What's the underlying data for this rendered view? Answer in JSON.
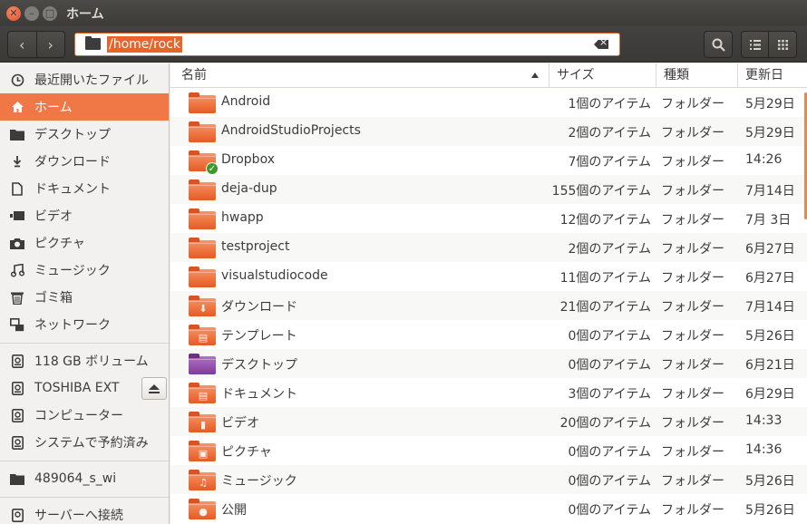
{
  "window": {
    "title": "ホーム"
  },
  "headerbar": {
    "path": "/home/rock"
  },
  "sidebar": {
    "items": [
      {
        "label": "最近開いたファイル",
        "icon": "clock-icon"
      },
      {
        "label": "ホーム",
        "icon": "home-icon",
        "active": true
      },
      {
        "label": "デスクトップ",
        "icon": "folder-icon"
      },
      {
        "label": "ダウンロード",
        "icon": "download-icon"
      },
      {
        "label": "ドキュメント",
        "icon": "document-icon"
      },
      {
        "label": "ビデオ",
        "icon": "video-icon"
      },
      {
        "label": "ピクチャ",
        "icon": "camera-icon"
      },
      {
        "label": "ミュージック",
        "icon": "music-icon"
      },
      {
        "label": "ゴミ箱",
        "icon": "trash-icon"
      },
      {
        "label": "ネットワーク",
        "icon": "network-icon"
      }
    ],
    "devices": [
      {
        "label": "118 GB ボリューム",
        "icon": "drive-icon"
      },
      {
        "label": "TOSHIBA EXT",
        "icon": "drive-icon",
        "ejectable": true
      },
      {
        "label": "コンピューター",
        "icon": "drive-icon"
      },
      {
        "label": "システムで予約済み",
        "icon": "drive-icon"
      }
    ],
    "bookmarks": [
      {
        "label": "489064_s_wi",
        "icon": "folder-icon"
      }
    ],
    "other": [
      {
        "label": "サーバーへ接続",
        "icon": "server-icon"
      }
    ]
  },
  "columns": {
    "name": "名前",
    "size": "サイズ",
    "type": "種類",
    "modified": "更新日"
  },
  "files": [
    {
      "name": "Android",
      "size": "1個のアイテム",
      "type": "フォルダー",
      "modified": "5月29日"
    },
    {
      "name": "AndroidStudioProjects",
      "size": "2個のアイテム",
      "type": "フォルダー",
      "modified": "5月29日"
    },
    {
      "name": "Dropbox",
      "size": "7個のアイテム",
      "type": "フォルダー",
      "modified": "14:26",
      "emblem": "check"
    },
    {
      "name": "deja-dup",
      "size": "155個のアイテム",
      "type": "フォルダー",
      "modified": "7月14日"
    },
    {
      "name": "hwapp",
      "size": "12個のアイテム",
      "type": "フォルダー",
      "modified": "7月 3日"
    },
    {
      "name": "testproject",
      "size": "2個のアイテム",
      "type": "フォルダー",
      "modified": "6月27日"
    },
    {
      "name": "visualstudiocode",
      "size": "11個のアイテム",
      "type": "フォルダー",
      "modified": "6月27日"
    },
    {
      "name": "ダウンロード",
      "size": "21個のアイテム",
      "type": "フォルダー",
      "modified": "7月14日",
      "emblem": "download"
    },
    {
      "name": "テンプレート",
      "size": "0個のアイテム",
      "type": "フォルダー",
      "modified": "5月26日",
      "emblem": "template"
    },
    {
      "name": "デスクトップ",
      "size": "0個のアイテム",
      "type": "フォルダー",
      "modified": "6月21日",
      "emblem": "desktop"
    },
    {
      "name": "ドキュメント",
      "size": "3個のアイテム",
      "type": "フォルダー",
      "modified": "6月29日",
      "emblem": "document"
    },
    {
      "name": "ビデオ",
      "size": "20個のアイテム",
      "type": "フォルダー",
      "modified": "14:33",
      "emblem": "video"
    },
    {
      "name": "ピクチャ",
      "size": "0個のアイテム",
      "type": "フォルダー",
      "modified": "14:36",
      "emblem": "picture"
    },
    {
      "name": "ミュージック",
      "size": "0個のアイテム",
      "type": "フォルダー",
      "modified": "5月26日",
      "emblem": "music"
    },
    {
      "name": "公開",
      "size": "0個のアイテム",
      "type": "フォルダー",
      "modified": "5月26日",
      "emblem": "public"
    }
  ]
}
